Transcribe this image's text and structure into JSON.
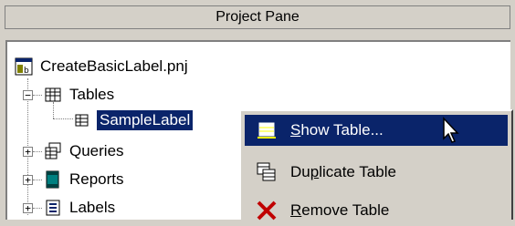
{
  "pane": {
    "title": "Project Pane"
  },
  "tree": {
    "project_file": "CreateBasicLabel.pnj",
    "items": [
      {
        "label": "Tables",
        "expander": "−"
      },
      {
        "label": "SampleLabel"
      },
      {
        "label": "Queries",
        "expander": "+"
      },
      {
        "label": "Reports",
        "expander": "+"
      },
      {
        "label": "Labels",
        "expander": "+"
      }
    ]
  },
  "context_menu": {
    "items": [
      {
        "pre": "",
        "accel": "S",
        "post": "how Table...",
        "icon": "show-table-icon"
      },
      {
        "pre": "Du",
        "accel": "p",
        "post": "licate Table",
        "icon": "duplicate-table-icon"
      },
      {
        "pre": "",
        "accel": "R",
        "post": "emove Table",
        "icon": "remove-table-icon"
      }
    ]
  },
  "colors": {
    "selection": "#0a246a",
    "background": "#d4d0c8",
    "tree_bg": "#ffffff"
  }
}
